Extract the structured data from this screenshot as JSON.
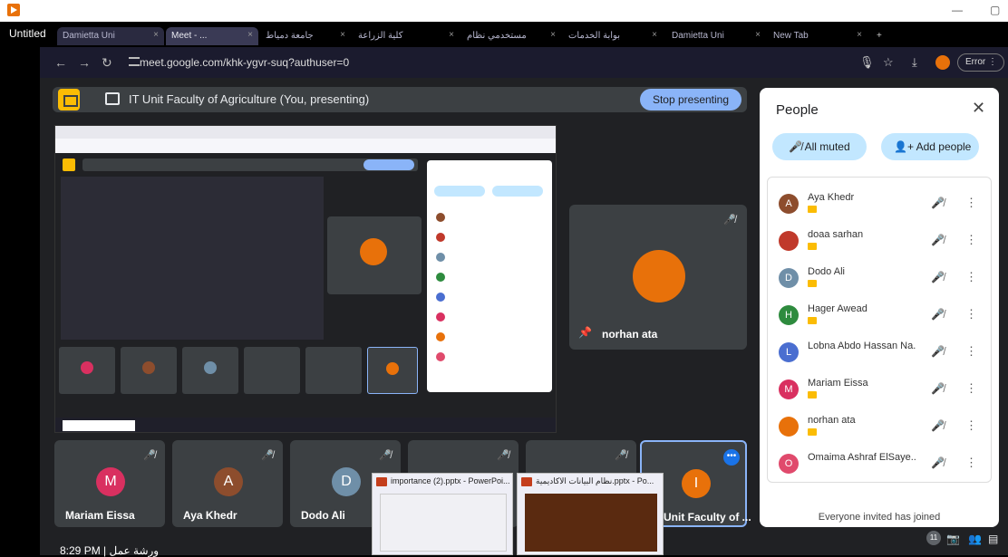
{
  "window": {
    "title": "Untitled"
  },
  "tabs": [
    {
      "label": "Damietta Uni"
    },
    {
      "label": "Meet - ..."
    },
    {
      "label": "جامعة دمياط"
    },
    {
      "label": "كلية الزراعة"
    },
    {
      "label": "مستخدمي نظام"
    },
    {
      "label": "بوابة الخدمات"
    },
    {
      "label": "Damietta Uni"
    },
    {
      "label": "New Tab"
    }
  ],
  "address": {
    "url": "meet.google.com/khk-ygvr-suq?authuser=0",
    "error_label": "Error"
  },
  "presenting": {
    "title": "IT Unit Faculty of Agriculture (You, presenting)",
    "stop_label": "Stop presenting"
  },
  "pinned_tile": {
    "name": "norhan ata"
  },
  "bottom_tiles": [
    {
      "initial": "M",
      "name": "Mariam Eissa",
      "color": "#d93060"
    },
    {
      "initial": "A",
      "name": "Aya Khedr",
      "color": "#8d4d2d"
    },
    {
      "initial": "D",
      "name": "Dodo Ali",
      "color": "#6f8fa8"
    },
    {
      "initial": "",
      "name": "",
      "color": "#e8710a"
    },
    {
      "initial": "I",
      "name": "Unit Faculty of ...",
      "color": "#e8710a"
    }
  ],
  "thumbnails": [
    {
      "title": "importance (2).pptx - PowerPoi..."
    },
    {
      "title": "نظام البيانات الاكاديمية.pptx - Po..."
    }
  ],
  "time_label": "8:29 PM | ورشة عمل",
  "people": {
    "title": "People",
    "all_muted_label": "All muted",
    "add_people_label": "Add people",
    "participants": [
      {
        "initial": "A",
        "name": "Aya Khedr",
        "color": "#8d4d2d"
      },
      {
        "initial": "",
        "name": "doaa sarhan",
        "color": "#c0392b"
      },
      {
        "initial": "D",
        "name": "Dodo Ali",
        "color": "#6f8fa8"
      },
      {
        "initial": "H",
        "name": "Hager Awead",
        "color": "#2e8b3e"
      },
      {
        "initial": "L",
        "name": "Lobna Abdo Hassan Na...",
        "color": "#4a6ed0"
      },
      {
        "initial": "M",
        "name": "Mariam Eissa",
        "color": "#d93060"
      },
      {
        "initial": "",
        "name": "norhan ata",
        "color": "#e8710a"
      },
      {
        "initial": "O",
        "name": "Omaima Ashraf ElSaye...",
        "color": "#e04a6c"
      }
    ],
    "invited_label": "Everyone invited has joined"
  },
  "bottom_counter": "11"
}
